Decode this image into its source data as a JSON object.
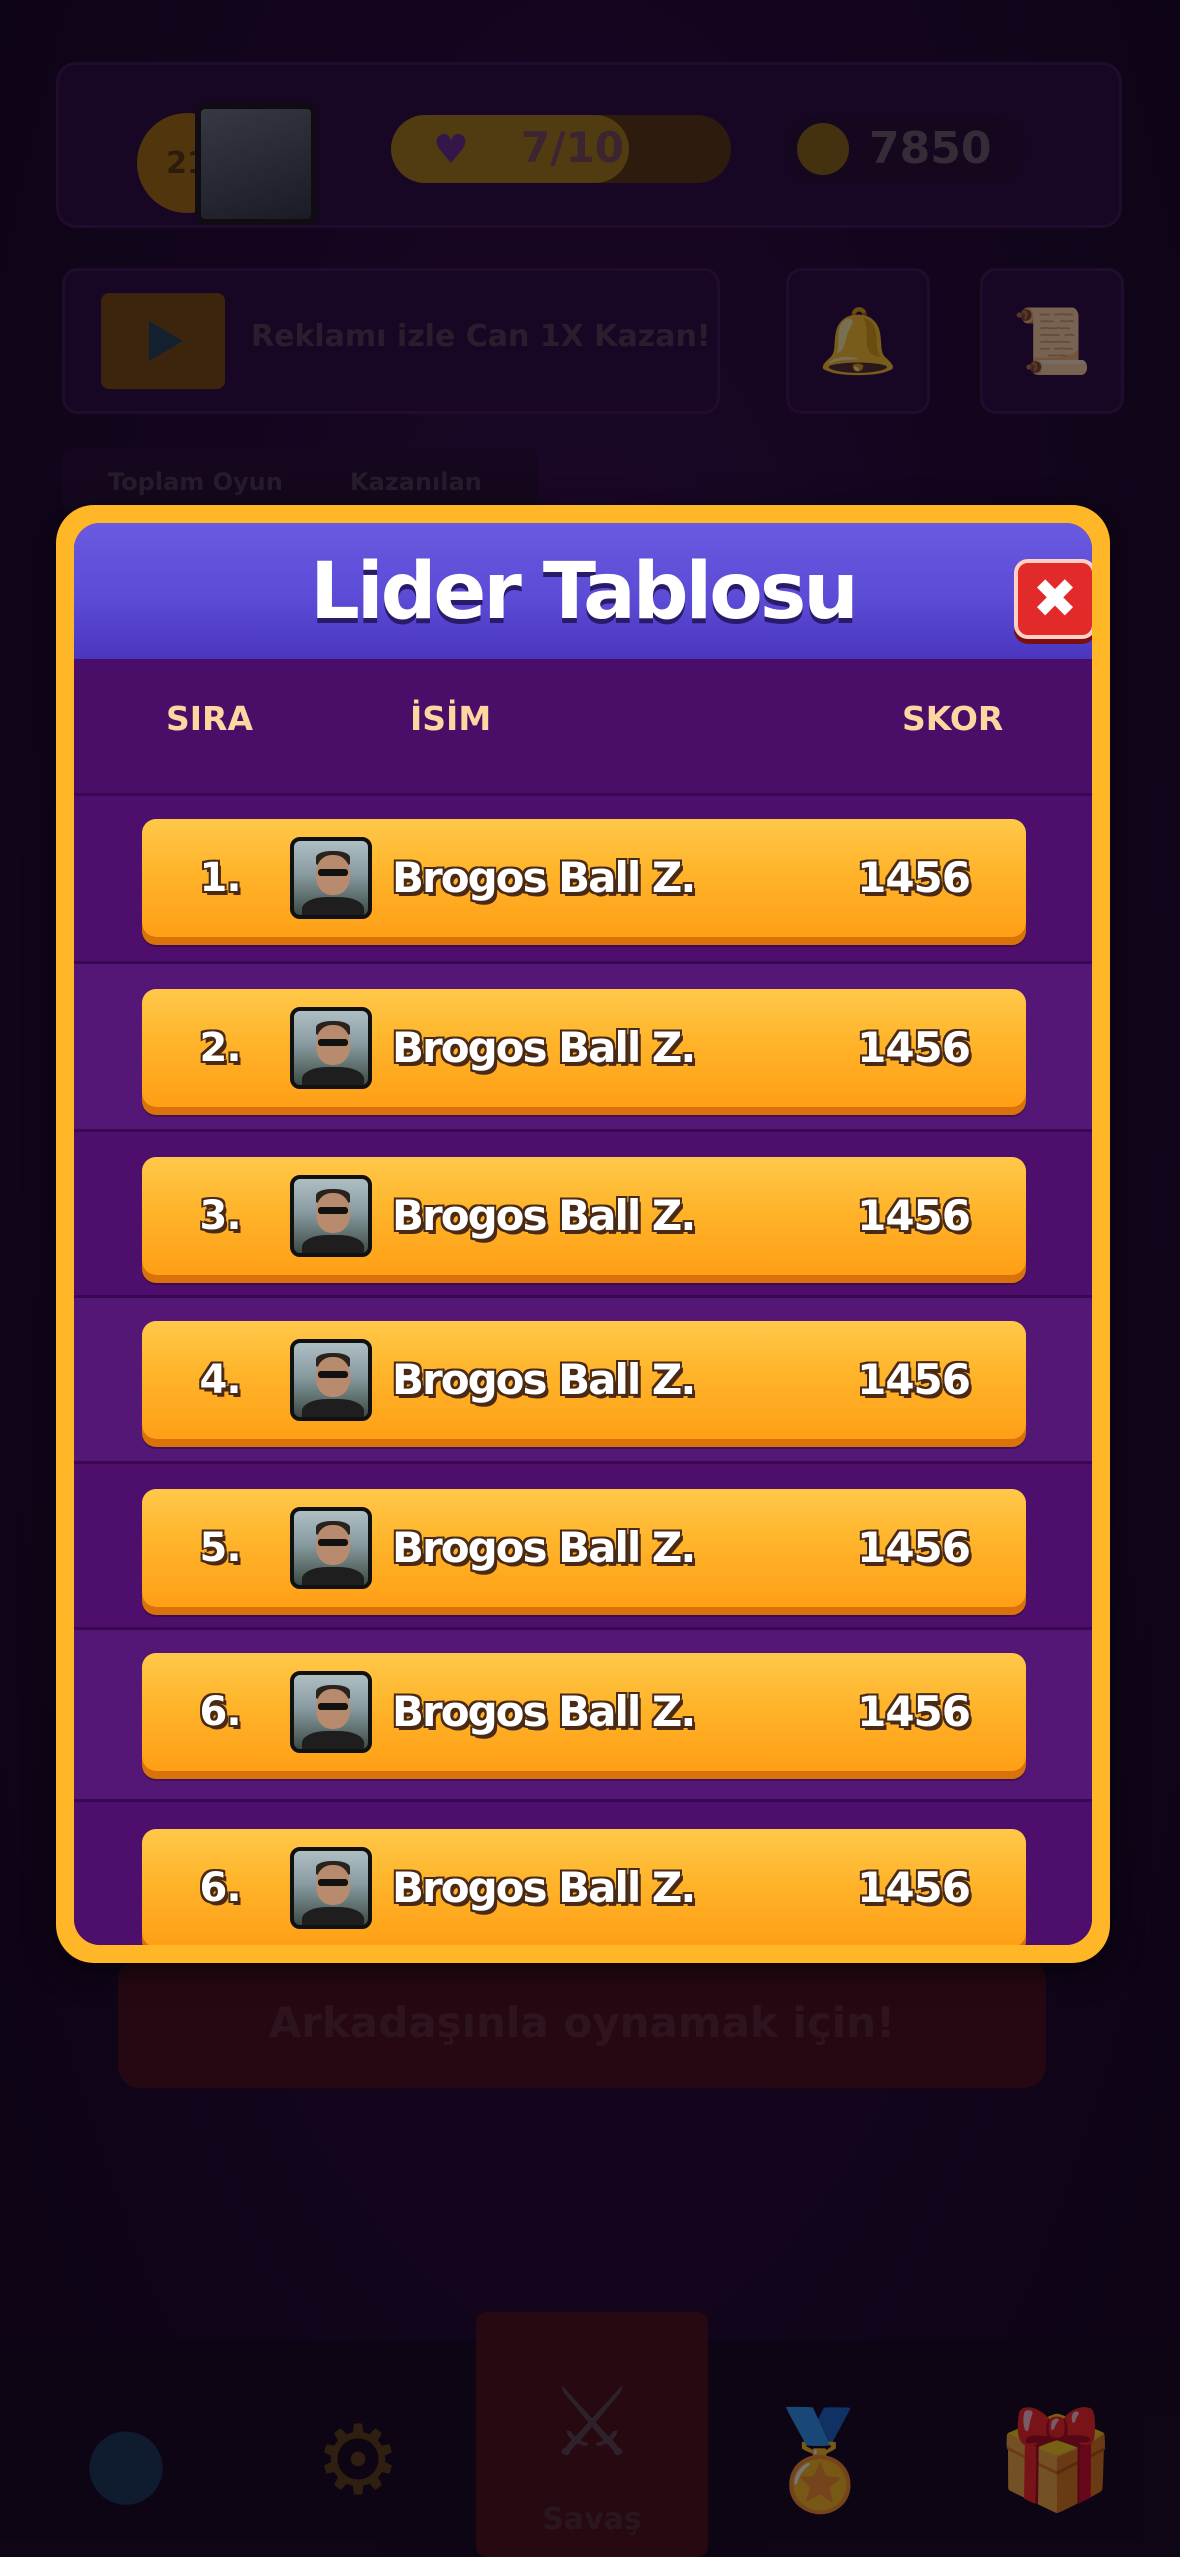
{
  "background": {
    "level": "21",
    "hearts": "7/10",
    "hearts_fraction": 0.7,
    "coins": "7850",
    "ad_text": "Reklamı izle Can 1X Kazan!",
    "tabs": [
      "Toplam Oyun",
      "Kazanılan"
    ],
    "friend_button": "Arkadaşınla oynamak için!",
    "nav": {
      "battle_label": "Savaş"
    }
  },
  "modal": {
    "title": "Lider Tablosu",
    "close_icon": "✖",
    "columns": {
      "rank": "SIRA",
      "name": "İSİM",
      "score": "SKOR"
    },
    "entries": [
      {
        "rank": "1.",
        "name": "Brogos Ball Z.",
        "score": "1456"
      },
      {
        "rank": "2.",
        "name": "Brogos Ball Z.",
        "score": "1456"
      },
      {
        "rank": "3.",
        "name": "Brogos Ball Z.",
        "score": "1456"
      },
      {
        "rank": "4.",
        "name": "Brogos Ball Z.",
        "score": "1456"
      },
      {
        "rank": "5.",
        "name": "Brogos Ball Z.",
        "score": "1456"
      },
      {
        "rank": "6.",
        "name": "Brogos Ball Z.",
        "score": "1456"
      },
      {
        "rank": "6.",
        "name": "Brogos Ball Z.",
        "score": "1456"
      }
    ]
  },
  "colors": {
    "modal_border": "#ffb627",
    "modal_body": "#4a0d68",
    "header": "#5b4bd6",
    "entry": "#ffb42a",
    "close_button": "#e32a2a"
  }
}
